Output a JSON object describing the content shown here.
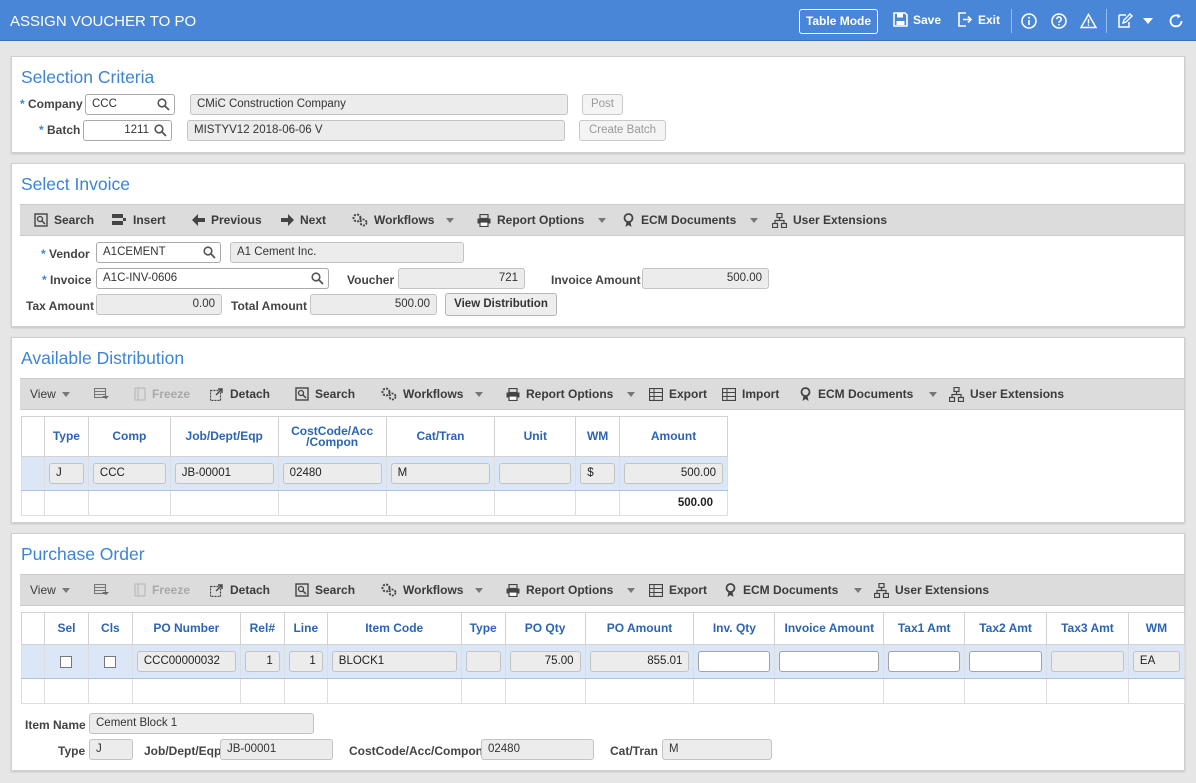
{
  "app": {
    "title": "ASSIGN VOUCHER TO PO"
  },
  "header": {
    "table_mode": "Table Mode",
    "save": "Save",
    "exit": "Exit"
  },
  "selection": {
    "title": "Selection Criteria",
    "company_label": "Company",
    "company_value": "CCC",
    "company_name": "CMiC Construction Company",
    "batch_label": "Batch",
    "batch_value": "1211",
    "batch_name": "MISTYV12 2018-06-06 V",
    "post_btn": "Post",
    "create_batch_btn": "Create Batch"
  },
  "invoice": {
    "title": "Select Invoice",
    "toolbar": {
      "search": "Search",
      "insert": "Insert",
      "previous": "Previous",
      "next": "Next",
      "workflows": "Workflows",
      "report_options": "Report Options",
      "ecm_documents": "ECM Documents",
      "user_extensions": "User Extensions"
    },
    "vendor_label": "Vendor",
    "vendor_value": "A1CEMENT",
    "vendor_name": "A1 Cement Inc.",
    "invoice_label": "Invoice",
    "invoice_value": "A1C-INV-0606",
    "voucher_label": "Voucher",
    "voucher_value": "721",
    "invoice_amount_label": "Invoice Amount",
    "invoice_amount_value": "500.00",
    "tax_amount_label": "Tax Amount",
    "tax_amount_value": "0.00",
    "total_amount_label": "Total Amount",
    "total_amount_value": "500.00",
    "view_distribution": "View Distribution"
  },
  "distribution": {
    "title": "Available Distribution",
    "toolbar": {
      "view": "View",
      "freeze": "Freeze",
      "detach": "Detach",
      "search": "Search",
      "workflows": "Workflows",
      "report_options": "Report Options",
      "export": "Export",
      "import": "Import",
      "ecm_documents": "ECM Documents",
      "user_extensions": "User Extensions"
    },
    "columns": [
      "Type",
      "Comp",
      "Job/Dept/Eqp",
      "CostCode/Acc\n/Compon",
      "Cat/Tran",
      "Unit",
      "WM",
      "Amount"
    ],
    "row": {
      "type": "J",
      "comp": "CCC",
      "job": "JB-00001",
      "costcode": "02480",
      "cat": "M",
      "unit": "",
      "wm": "$",
      "amount": "500.00"
    },
    "total": "500.00"
  },
  "po": {
    "title": "Purchase Order",
    "toolbar": {
      "view": "View",
      "freeze": "Freeze",
      "detach": "Detach",
      "search": "Search",
      "workflows": "Workflows",
      "report_options": "Report Options",
      "export": "Export",
      "ecm_documents": "ECM Documents",
      "user_extensions": "User Extensions"
    },
    "columns": [
      "Sel",
      "Cls",
      "PO Number",
      "Rel#",
      "Line",
      "Item Code",
      "Type",
      "PO Qty",
      "PO Amount",
      "Inv. Qty",
      "Invoice Amount",
      "Tax1 Amt",
      "Tax2 Amt",
      "Tax3 Amt",
      "WM"
    ],
    "row": {
      "po_number": "CCC00000032",
      "rel": "1",
      "line": "1",
      "item_code": "BLOCK1",
      "type": "",
      "po_qty": "75.00",
      "po_amount": "855.01",
      "inv_qty": "",
      "invoice_amount": "",
      "tax1": "",
      "tax2": "",
      "tax3": "",
      "wm": "EA"
    },
    "item_name_label": "Item Name",
    "item_name_value": "Cement Block 1",
    "type_label": "Type",
    "type_value": "J",
    "job_label": "Job/Dept/Eqp",
    "job_value": "JB-00001",
    "costcode_label": "CostCode/Acc/Compon",
    "costcode_value": "02480",
    "cat_label": "Cat/Tran",
    "cat_value": "M"
  }
}
